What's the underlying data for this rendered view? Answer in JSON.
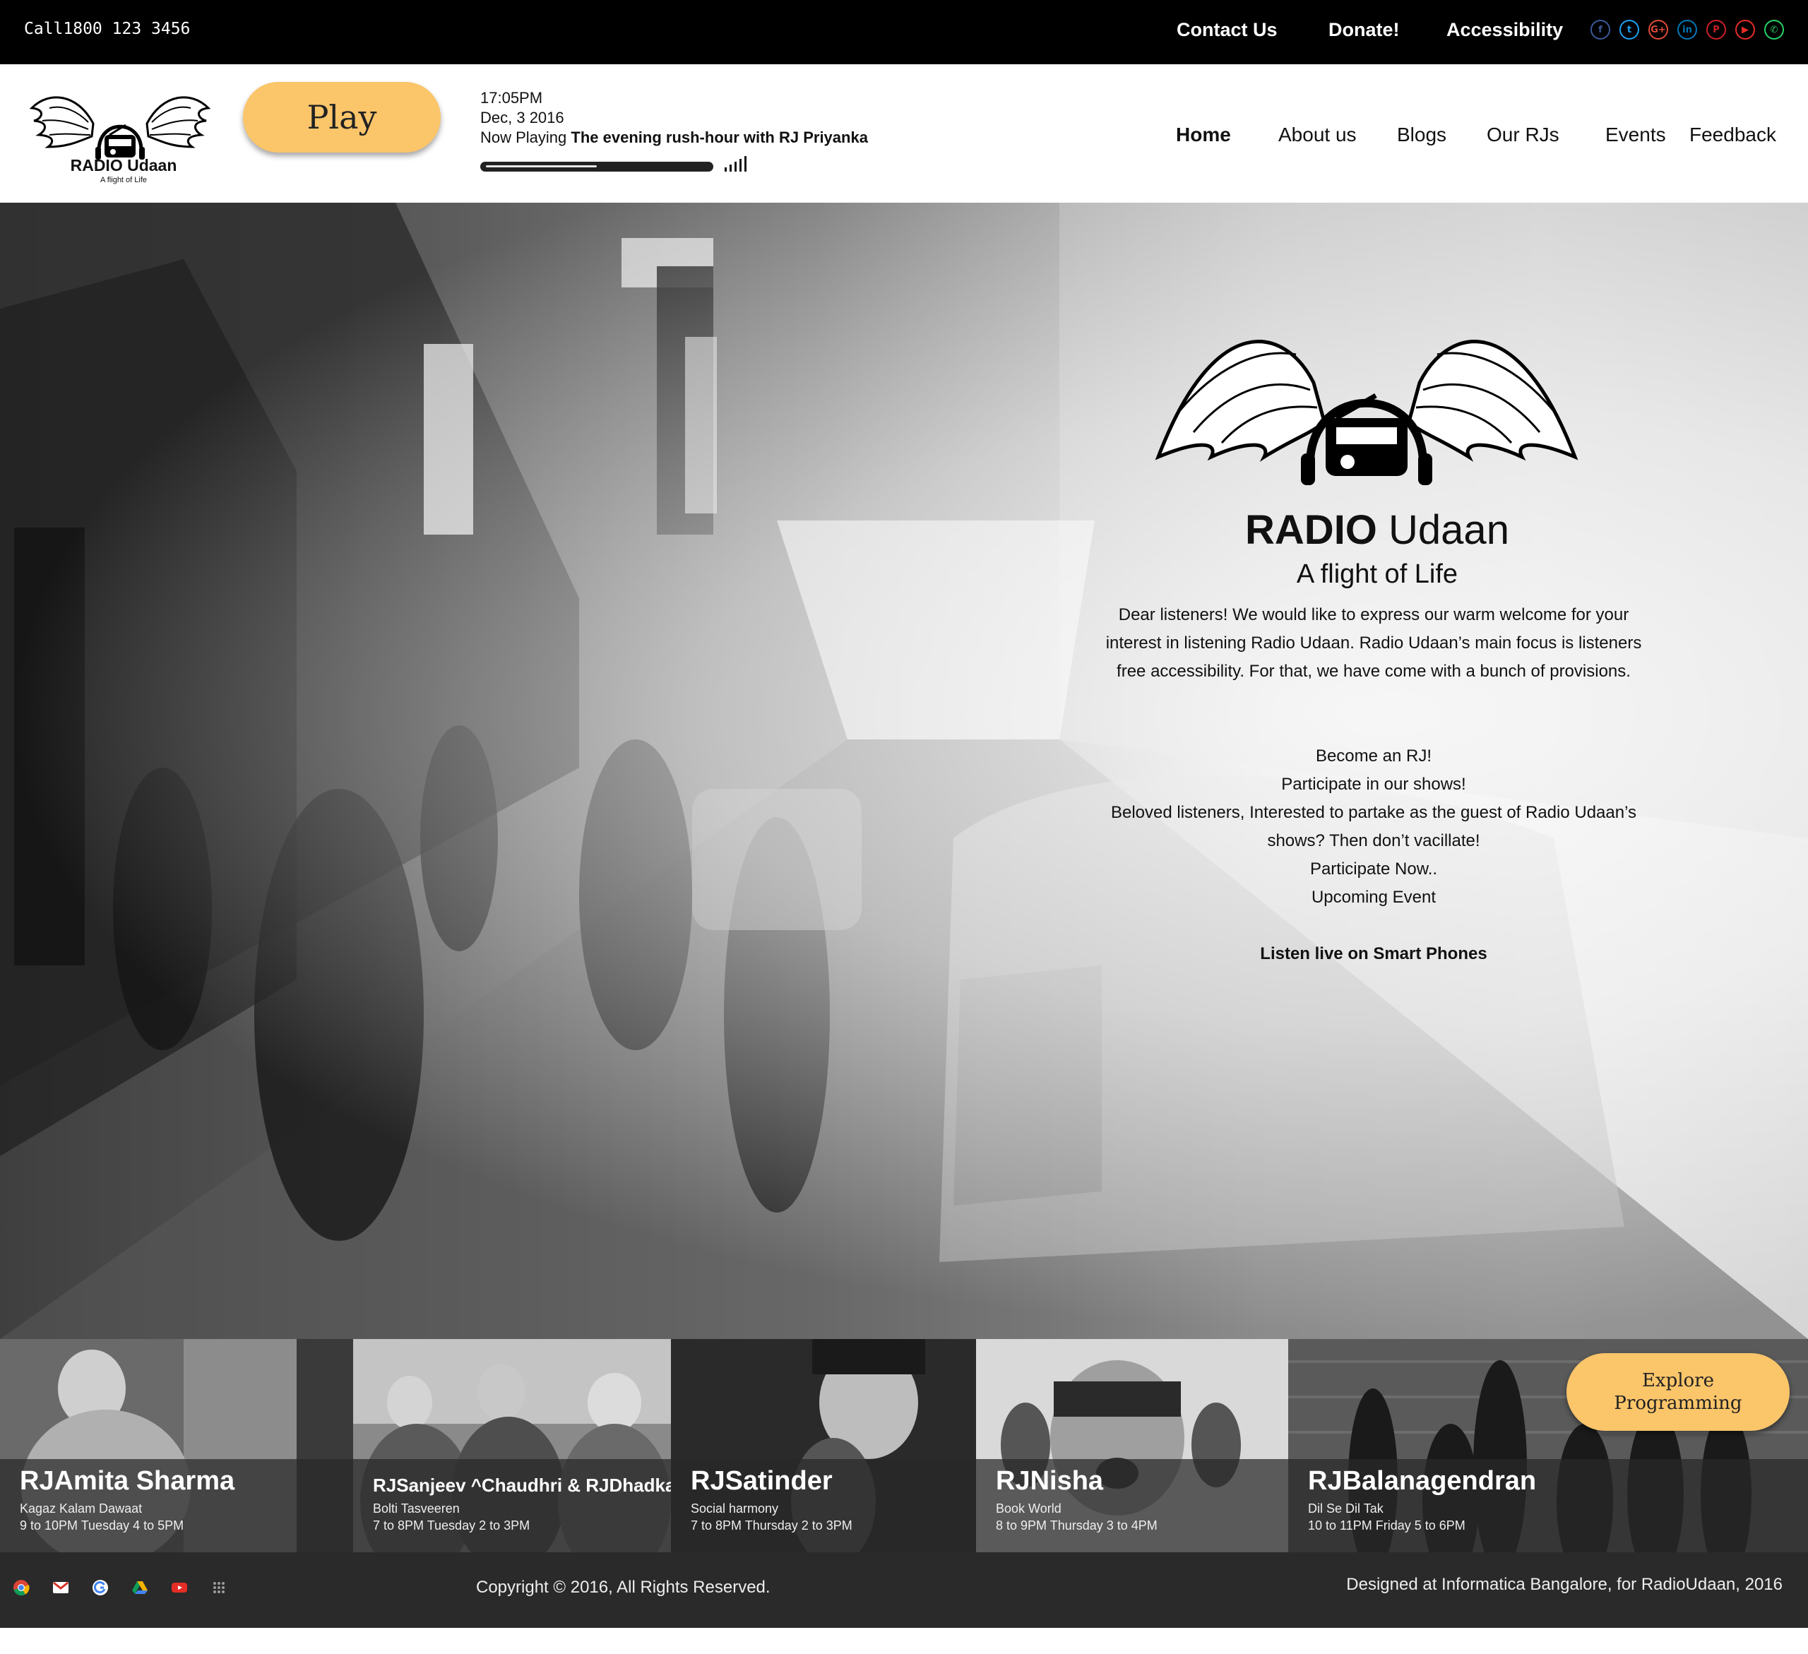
{
  "topbar": {
    "call": "Call1800 123 3456",
    "links": [
      "Contact Us",
      "Donate!",
      "Accessibility"
    ],
    "social": [
      {
        "icon": "facebook-icon",
        "glyph": "f",
        "color": "#3b5998"
      },
      {
        "icon": "twitter-icon",
        "glyph": "t",
        "color": "#1da1f2"
      },
      {
        "icon": "google-plus-icon",
        "glyph": "G+",
        "color": "#dd4b39"
      },
      {
        "icon": "linkedin-icon",
        "glyph": "in",
        "color": "#0077b5"
      },
      {
        "icon": "pinterest-icon",
        "glyph": "P",
        "color": "#cb2027"
      },
      {
        "icon": "youtube-icon",
        "glyph": "▶",
        "color": "#e52d27"
      },
      {
        "icon": "whatsapp-icon",
        "glyph": "✆",
        "color": "#25d366"
      }
    ]
  },
  "header": {
    "brand": "RADIO Udaan",
    "tagline": "A flight of Life",
    "play_label": "Play",
    "time": "17:05PM",
    "date": "Dec, 3 2016",
    "now_playing_label": "Now Playing",
    "now_playing_show": "The evening rush-hour with RJ Priyanka",
    "progress": 0.5,
    "nav": [
      "Home",
      "About us",
      "Blogs",
      "Our RJs",
      "Events",
      "Feedback"
    ]
  },
  "hero": {
    "brand_bold": "RADIO",
    "brand_rest": " Udaan",
    "subtitle": "A flight of Life",
    "intro_lines": [
      "Dear listeners! We would like to express our warm welcome for your",
      "interest in listening Radio Udaan. Radio Udaan’s main focus is listeners",
      "free accessibility. For that, we have come with a bunch of provisions."
    ],
    "become_rj": "Become an RJ!",
    "participate": "Participate in our shows!",
    "beloved_lines": [
      "Beloved listeners, Interested to partake as the guest of Radio Udaan’s",
      "shows? Then don’t vacillate!"
    ],
    "participate_now": "Participate Now..",
    "upcoming": "Upcoming  Event",
    "listen_live": "Listen live on Smart Phones"
  },
  "rjs": [
    {
      "name": "RJAmita Sharma",
      "show": "Kagaz Kalam Dawaat",
      "time": "9 to 10PM    Tuesday 4 to 5PM"
    },
    {
      "name": "RJSanjeev ^Chaudhri & RJDhadkan",
      "show": "Bolti Tasveeren",
      "time": "7 to 8PM Tuesday 2 to 3PM"
    },
    {
      "name": "RJSatinder",
      "show": "Social harmony",
      "time": "7 to 8PM Thursday 2 to 3PM"
    },
    {
      "name": "RJNisha",
      "show": "Book World",
      "time": "8 to 9PM Thursday 3 to 4PM"
    },
    {
      "name": "RJBalanagendran",
      "show": "Dil Se Dil Tak",
      "time": "10 to 11PM   Friday 5 to 6PM"
    }
  ],
  "explore": {
    "line1": "Explore",
    "line2": "Programming"
  },
  "footer": {
    "apps": [
      "chrome-icon",
      "gmail-icon",
      "google-icon",
      "drive-icon",
      "youtube-icon",
      "apps-grid-icon"
    ],
    "copyright": "Copyright © 2016, All Rights Reserved.",
    "designed": "Designed at Informatica Bangalore, for  RadioUdaan, 2016"
  },
  "colors": {
    "accent": "#fbc56a",
    "topbar": "#000000",
    "footer": "#2a2a2a"
  }
}
